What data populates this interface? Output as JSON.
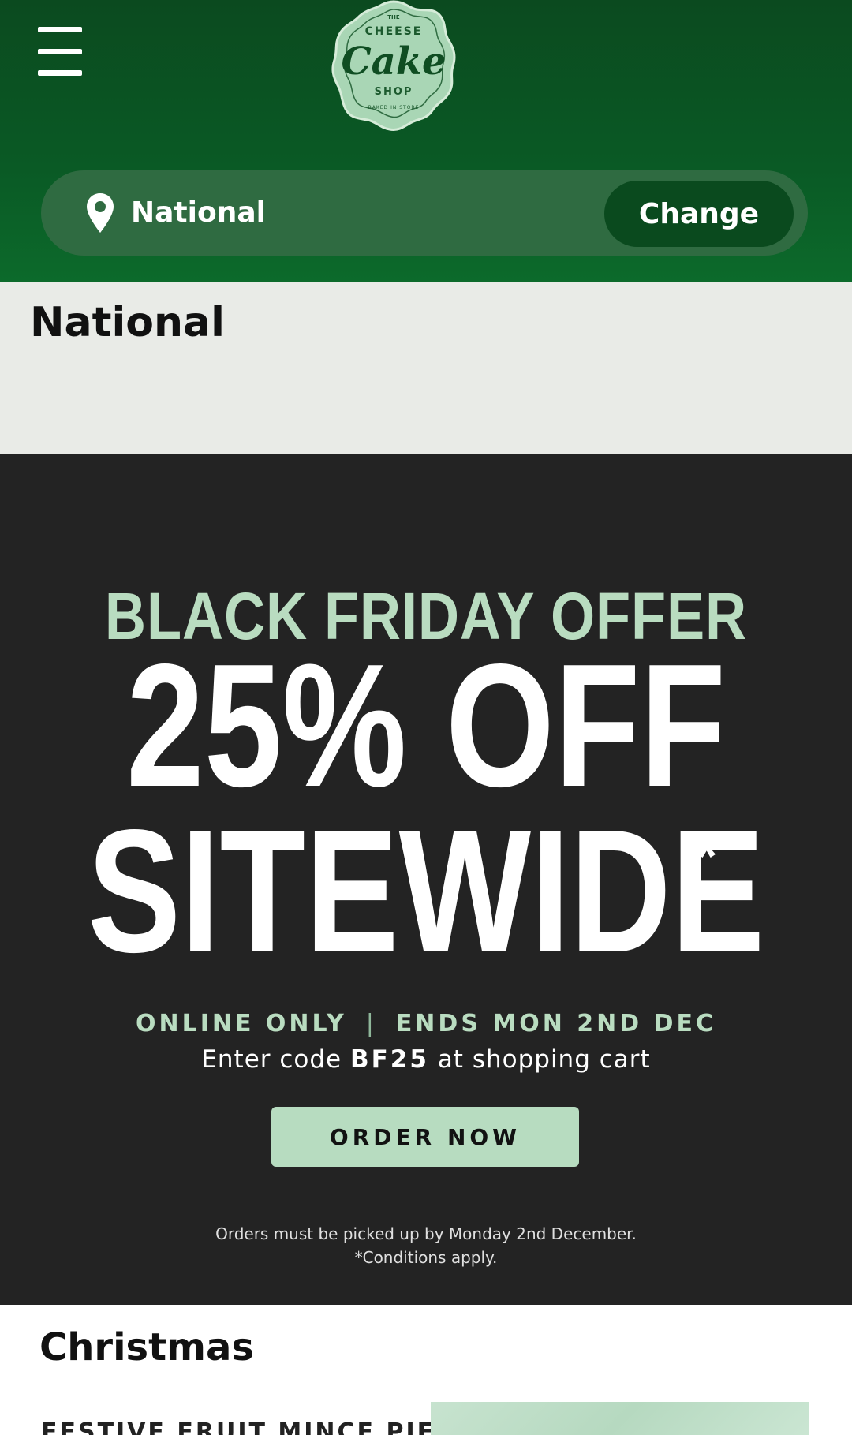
{
  "header": {
    "menu_icon": "hamburger-menu-icon",
    "logo": {
      "top": "THE",
      "line1": "CHEESE",
      "line2": "Cake",
      "line3": "SHOP",
      "tagline": "BAKED IN STORE"
    },
    "location": {
      "icon": "location-pin-icon",
      "label": "National",
      "change_label": "Change"
    }
  },
  "location_section": {
    "title": "National"
  },
  "promo": {
    "kicker": "BLACK FRIDAY OFFER",
    "headline_line1": "25% OFF",
    "headline_line2": "SITEWIDE",
    "asterisk": "*",
    "meta_left": "ONLINE ONLY",
    "meta_separator": "|",
    "meta_right": "ENDS MON 2ND DEC",
    "code_prefix": "Enter code",
    "code": "BF25",
    "code_suffix": "at shopping cart",
    "cta_label": "ORDER NOW",
    "note_line1": "Orders must be picked up by Monday 2nd December.",
    "note_line2": "*Conditions apply."
  },
  "christmas": {
    "title": "Christmas",
    "first_product_title": "FESTIVE FRUIT MINCE PIE"
  },
  "colors": {
    "header_green": "#0a5a25",
    "location_bar": "#2f6b41",
    "change_button": "#0a4a1e",
    "promo_bg": "#232323",
    "accent_mint": "#b9dcc0"
  }
}
